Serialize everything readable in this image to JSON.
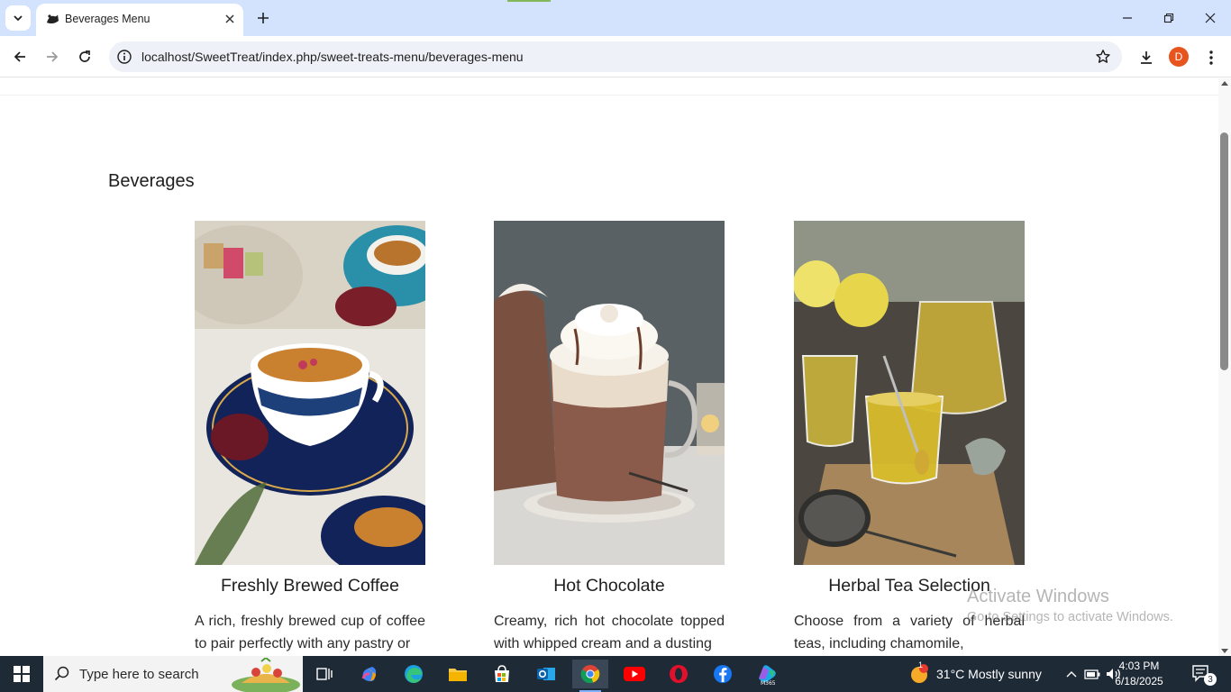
{
  "browser": {
    "tab_title": "Beverages Menu",
    "url": "localhost/SweetTreat/index.php/sweet-treats-menu/beverages-menu",
    "profile_initial": "D"
  },
  "page": {
    "section_title": "Beverages",
    "items": [
      {
        "title": "Freshly Brewed Coffee",
        "description": "A rich, freshly brewed cup of coffee to pair perfectly with any pastry or",
        "image": "coffee-cups-with-turkish-delight"
      },
      {
        "title": "Hot Chocolate",
        "description": "Creamy, rich hot chocolate topped with whipped cream and a dusting",
        "image": "hot-chocolate-glass-mug"
      },
      {
        "title": "Herbal Tea Selection",
        "description": "Choose from a variety of herbal teas, including chamomile,",
        "image": "herbal-tea-glasses-with-lemon"
      }
    ],
    "watermark": {
      "line1": "Activate Windows",
      "line2": "Go to Settings to activate Windows."
    }
  },
  "taskbar": {
    "search_placeholder": "Type here to search",
    "weather": "31°C  Mostly sunny",
    "time": "4:03 PM",
    "date": "6/18/2025",
    "notification_count": "3",
    "weather_badge": "1"
  },
  "colors": {
    "chrome_frame": "#d3e3fd",
    "omnibox": "#eef1f8",
    "avatar": "#e8541e",
    "taskbar": "#1f2a37"
  }
}
